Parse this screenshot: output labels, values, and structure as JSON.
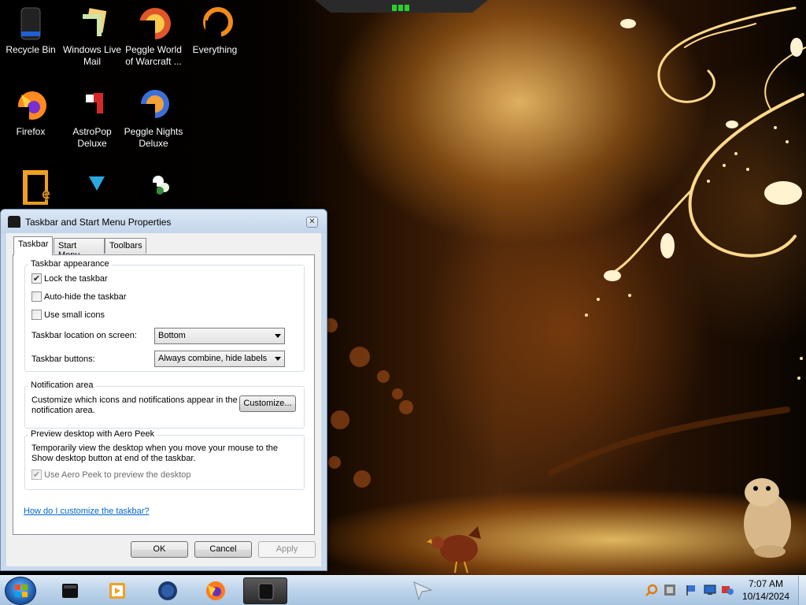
{
  "desktop": {
    "icons": [
      {
        "label": "Recycle Bin",
        "icon": "recycle-bin-icon"
      },
      {
        "label": "Windows Live Mail",
        "icon": "mail-icon"
      },
      {
        "label": "Peggle World of Warcraft ...",
        "icon": "peggle-wow-icon"
      },
      {
        "label": "Everything",
        "icon": "everything-search-icon"
      },
      {
        "label": "Firefox",
        "icon": "firefox-icon"
      },
      {
        "label": "AstroPop Deluxe",
        "icon": "astropop-icon"
      },
      {
        "label": "Peggle Nights Deluxe",
        "icon": "peggle-nights-icon"
      }
    ]
  },
  "dialog": {
    "title": "Taskbar and Start Menu Properties",
    "close_glyph": "✕",
    "tabs": [
      {
        "label": "Taskbar",
        "active": true
      },
      {
        "label": "Start Menu",
        "active": false
      },
      {
        "label": "Toolbars",
        "active": false
      }
    ],
    "appearance": {
      "title": "Taskbar appearance",
      "lock": {
        "label": "Lock the taskbar",
        "checked": true
      },
      "autohide": {
        "label": "Auto-hide the taskbar",
        "checked": false
      },
      "small_icons": {
        "label": "Use small icons",
        "checked": false
      },
      "location_label": "Taskbar location on screen:",
      "location_value": "Bottom",
      "buttons_label": "Taskbar buttons:",
      "buttons_value": "Always combine, hide labels"
    },
    "notification": {
      "title": "Notification area",
      "line1": "Customize which icons and notifications appear in the",
      "line2": "notification area.",
      "customize_button": "Customize..."
    },
    "aero_peek": {
      "title": "Preview desktop with Aero Peek",
      "line1": "Temporarily view the desktop when you move your mouse to the",
      "line2": "Show desktop button at end of the taskbar.",
      "checkbox_label": "Use Aero Peek to preview the desktop",
      "checked": true,
      "disabled": true
    },
    "help_link": "How do I customize the taskbar?",
    "buttons": {
      "ok": "OK",
      "cancel": "Cancel",
      "apply": "Apply"
    },
    "check_glyph": "✔"
  },
  "taskbar": {
    "pinned": [
      "explorer-icon",
      "media-player-icon",
      "network-globe-icon",
      "firefox-icon",
      "taskbar-properties-icon"
    ],
    "clock_time": "7:07 AM",
    "clock_date": "10/14/2024"
  }
}
